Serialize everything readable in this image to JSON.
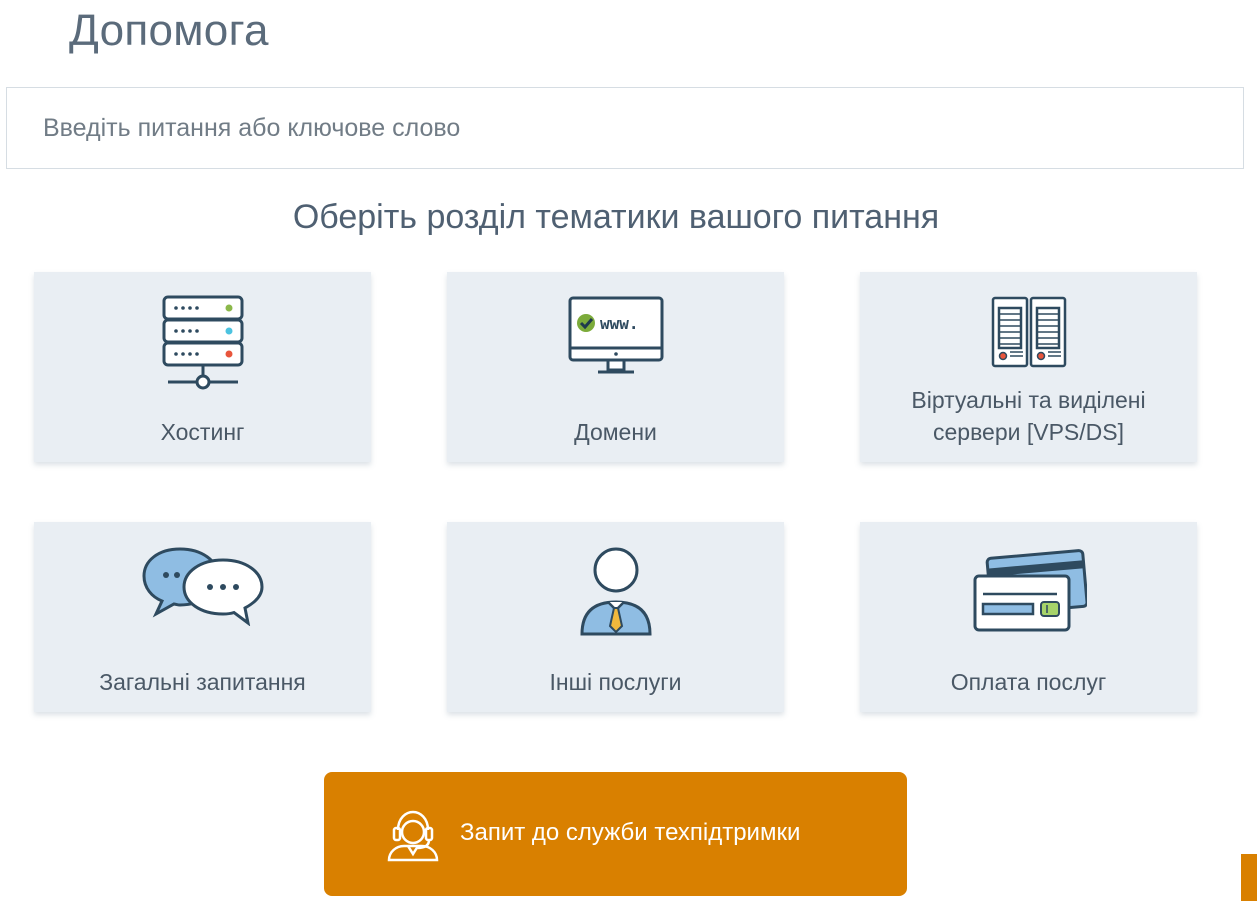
{
  "page": {
    "title": "Допомога"
  },
  "search": {
    "placeholder": "Введіть питання або ключове слово",
    "value": ""
  },
  "section": {
    "heading": "Оберіть розділ тематики вашого питання"
  },
  "categories": [
    {
      "label": "Хостинг",
      "icon": "server-rack-icon"
    },
    {
      "label": "Домени",
      "icon": "monitor-www-icon"
    },
    {
      "label": "Віртуальні та виділені сервери [VPS/DS]",
      "icon": "dedicated-servers-icon"
    },
    {
      "label": "Загальні запитання",
      "icon": "chat-bubbles-icon"
    },
    {
      "label": "Інші послуги",
      "icon": "person-tie-icon"
    },
    {
      "label": "Оплата послуг",
      "icon": "credit-cards-icon"
    }
  ],
  "domain_icon_text": "www.",
  "support": {
    "label": "Запит до служби техпідтримки",
    "icon": "headset-operator-icon"
  },
  "colors": {
    "accent": "#d98000",
    "card_bg": "#e9eef3",
    "icon_stroke": "#2e4a5f"
  }
}
